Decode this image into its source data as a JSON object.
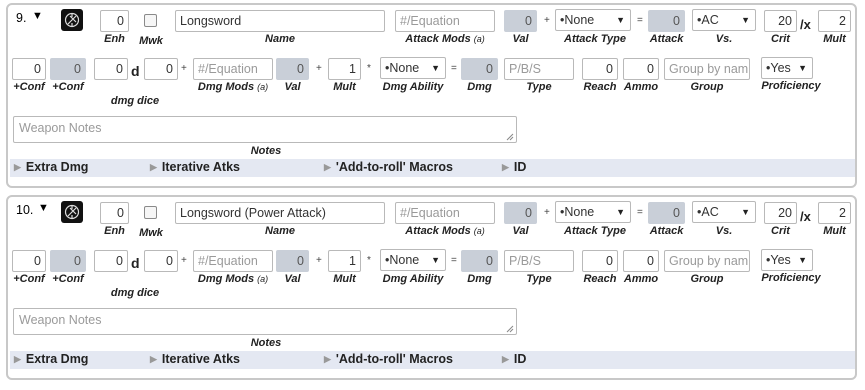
{
  "weapons": [
    {
      "index": "9.",
      "toggle_icon": "caret-down",
      "enh": "0",
      "mwk_checked": false,
      "name": "Longsword",
      "attack_mods_placeholder": "#/Equation",
      "val": "0",
      "attack_type": "•None",
      "attack": "0",
      "vs": "•AC",
      "crit": "20",
      "crit_mult": "2",
      "plus_conf": "0",
      "plus_conf_ro": "0",
      "dmg_dice_count": "0",
      "dmg_dice_sides": "0",
      "dmg_mods_placeholder": "#/Equation",
      "dmg_val": "0",
      "dmg_mult": "1",
      "dmg_ability": "•None",
      "dmg": "0",
      "type_placeholder": "P/B/S",
      "reach": "0",
      "ammo": "0",
      "group_placeholder": "Group by nam",
      "proficiency": "•Yes",
      "notes_placeholder": "Weapon Notes"
    },
    {
      "index": "10.",
      "toggle_icon": "caret-down",
      "enh": "0",
      "mwk_checked": false,
      "name": "Longsword (Power Attack)",
      "attack_mods_placeholder": "#/Equation",
      "val": "0",
      "attack_type": "•None",
      "attack": "0",
      "vs": "•AC",
      "crit": "20",
      "crit_mult": "2",
      "plus_conf": "0",
      "plus_conf_ro": "0",
      "dmg_dice_count": "0",
      "dmg_dice_sides": "0",
      "dmg_mods_placeholder": "#/Equation",
      "dmg_val": "0",
      "dmg_mult": "1",
      "dmg_ability": "•None",
      "dmg": "0",
      "type_placeholder": "P/B/S",
      "reach": "0",
      "ammo": "0",
      "group_placeholder": "Group by nam",
      "proficiency": "•Yes",
      "notes_placeholder": "Weapon Notes"
    }
  ],
  "labels": {
    "enh": "Enh",
    "mwk": "Mwk",
    "name": "Name",
    "attack_mods": "Attack Mods",
    "attack_mods_info": "(a)",
    "val": "Val",
    "attack_type": "Attack Type",
    "attack": "Attack",
    "vs": "Vs.",
    "crit": "Crit",
    "mult": "Mult",
    "plus_conf": "+Conf",
    "plus_conf_2": "+Conf",
    "dmg_dice": "dmg dice",
    "dmg_mods": "Dmg Mods",
    "dmg_mods_info": "(a)",
    "dmg_val": "Val",
    "dmg_mult": "Mult",
    "dmg_ability": "Dmg Ability",
    "dmg": "Dmg",
    "type": "Type",
    "reach": "Reach",
    "ammo": "Ammo",
    "group": "Group",
    "proficiency": "Proficiency",
    "notes": "Notes",
    "d": "d",
    "plus": "+",
    "equals": "=",
    "times": "*",
    "crit_x": "/x"
  },
  "sections": [
    "Extra Dmg",
    "Iterative Atks",
    "'Add-to-roll' Macros",
    "ID"
  ],
  "colors": {
    "readonly_bg": "#c9cfd8",
    "section_bar": "#e4e8f2",
    "border": "#c8c8c8"
  }
}
